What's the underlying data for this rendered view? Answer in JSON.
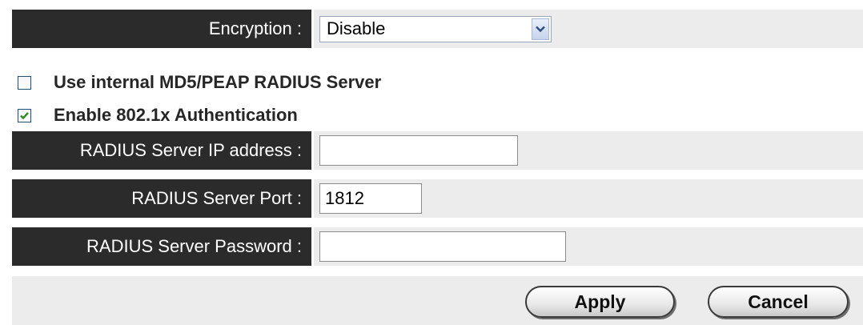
{
  "encryption": {
    "label": "Encryption :",
    "selected": "Disable"
  },
  "options": {
    "internal_radius": {
      "label": "Use internal MD5/PEAP RADIUS Server",
      "checked": false
    },
    "enable_8021x": {
      "label": "Enable 802.1x Authentication",
      "checked": true
    }
  },
  "radius": {
    "ip_label": "RADIUS Server IP address :",
    "ip_value": "",
    "port_label": "RADIUS Server Port :",
    "port_value": "1812",
    "password_label": "RADIUS Server Password :",
    "password_value": ""
  },
  "actions": {
    "apply_label": "Apply",
    "cancel_label": "Cancel"
  },
  "icons": {
    "dropdown": "chevron-down-icon",
    "check": "checkmark-icon"
  },
  "colors": {
    "label_background": "#2b2b2b",
    "value_background": "#ececec",
    "checkmark": "#2e8b22"
  }
}
